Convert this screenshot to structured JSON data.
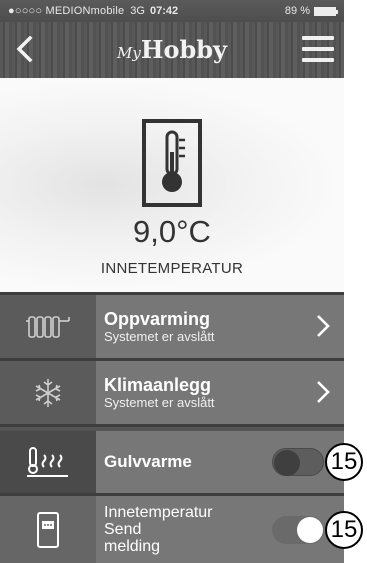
{
  "status_bar": {
    "carrier": "●○○○○ MEDIONmobile",
    "network": "3G",
    "time": "07:42",
    "battery": "89 %"
  },
  "header": {
    "brand_script": "My",
    "brand_word": "Hobby",
    "back_icon": "chevron-left-icon",
    "menu_icon": "hamburger-menu-icon"
  },
  "hero": {
    "icon": "thermometer-icon",
    "temperature": "9,0°C",
    "label": "INNETEMPERATUR"
  },
  "rows": [
    {
      "id": "oppvarming",
      "icon": "radiator-icon",
      "title": "Oppvarming",
      "subtitle": "Systemet er avslått"
    },
    {
      "id": "klimaanlegg",
      "icon": "snowflake-icon",
      "title": "Klimaanlegg",
      "subtitle": "Systemet er avslått"
    },
    {
      "id": "gulvvarme",
      "icon": "floor-heating-icon",
      "title": "Gulvvarme",
      "toggle": "off"
    },
    {
      "id": "notify",
      "icon": "phone-message-icon",
      "line1": "Innetemperatur",
      "line2": "Send",
      "line3": "melding",
      "toggle": "on"
    }
  ],
  "callouts": [
    "15",
    "15"
  ],
  "colors": {
    "panel_dark": "#5b5b5b",
    "panel_mid": "#777777",
    "hero_bg": "#f5f5f5"
  }
}
